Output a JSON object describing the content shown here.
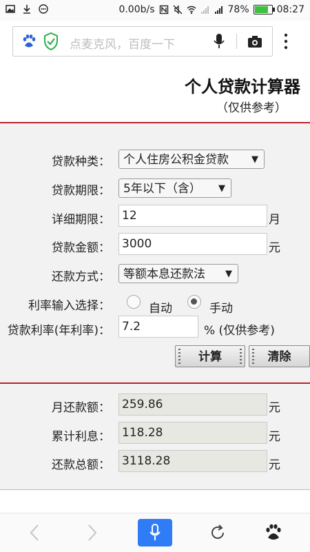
{
  "status_bar": {
    "speed": "0.00b/s",
    "battery": "78%",
    "battery_level": 0.78,
    "time": "08:27"
  },
  "browser": {
    "search_placeholder": "点麦克风，百度一下"
  },
  "page": {
    "title": "个人贷款计算器",
    "subtitle": "（仅供参考）"
  },
  "form": {
    "loan_type_label": "贷款种类：",
    "loan_type_value": "个人住房公积金贷款",
    "term_label": "贷款期限：",
    "term_value": "5年以下（含）",
    "detail_term_label": "详细期限：",
    "detail_term_value": "12",
    "detail_term_unit": "月",
    "amount_label": "贷款金额：",
    "amount_value": "3000",
    "amount_unit": "元",
    "repay_label": "还款方式：",
    "repay_value": "等额本息还款法",
    "rate_choice_label": "利率输入选择：",
    "rate_auto": "自动",
    "rate_manual": "手动",
    "rate_label": "贷款利率(年利率)：",
    "rate_value": "7.2",
    "rate_unit": "% (仅供参考)",
    "calc_button": "计算",
    "clear_button": "清除"
  },
  "results": {
    "monthly_label": "月还款额：",
    "monthly_value": "259.86",
    "interest_label": "累计利息：",
    "interest_value": "118.28",
    "total_label": "还款总额：",
    "total_value": "3118.28",
    "unit": "元"
  }
}
